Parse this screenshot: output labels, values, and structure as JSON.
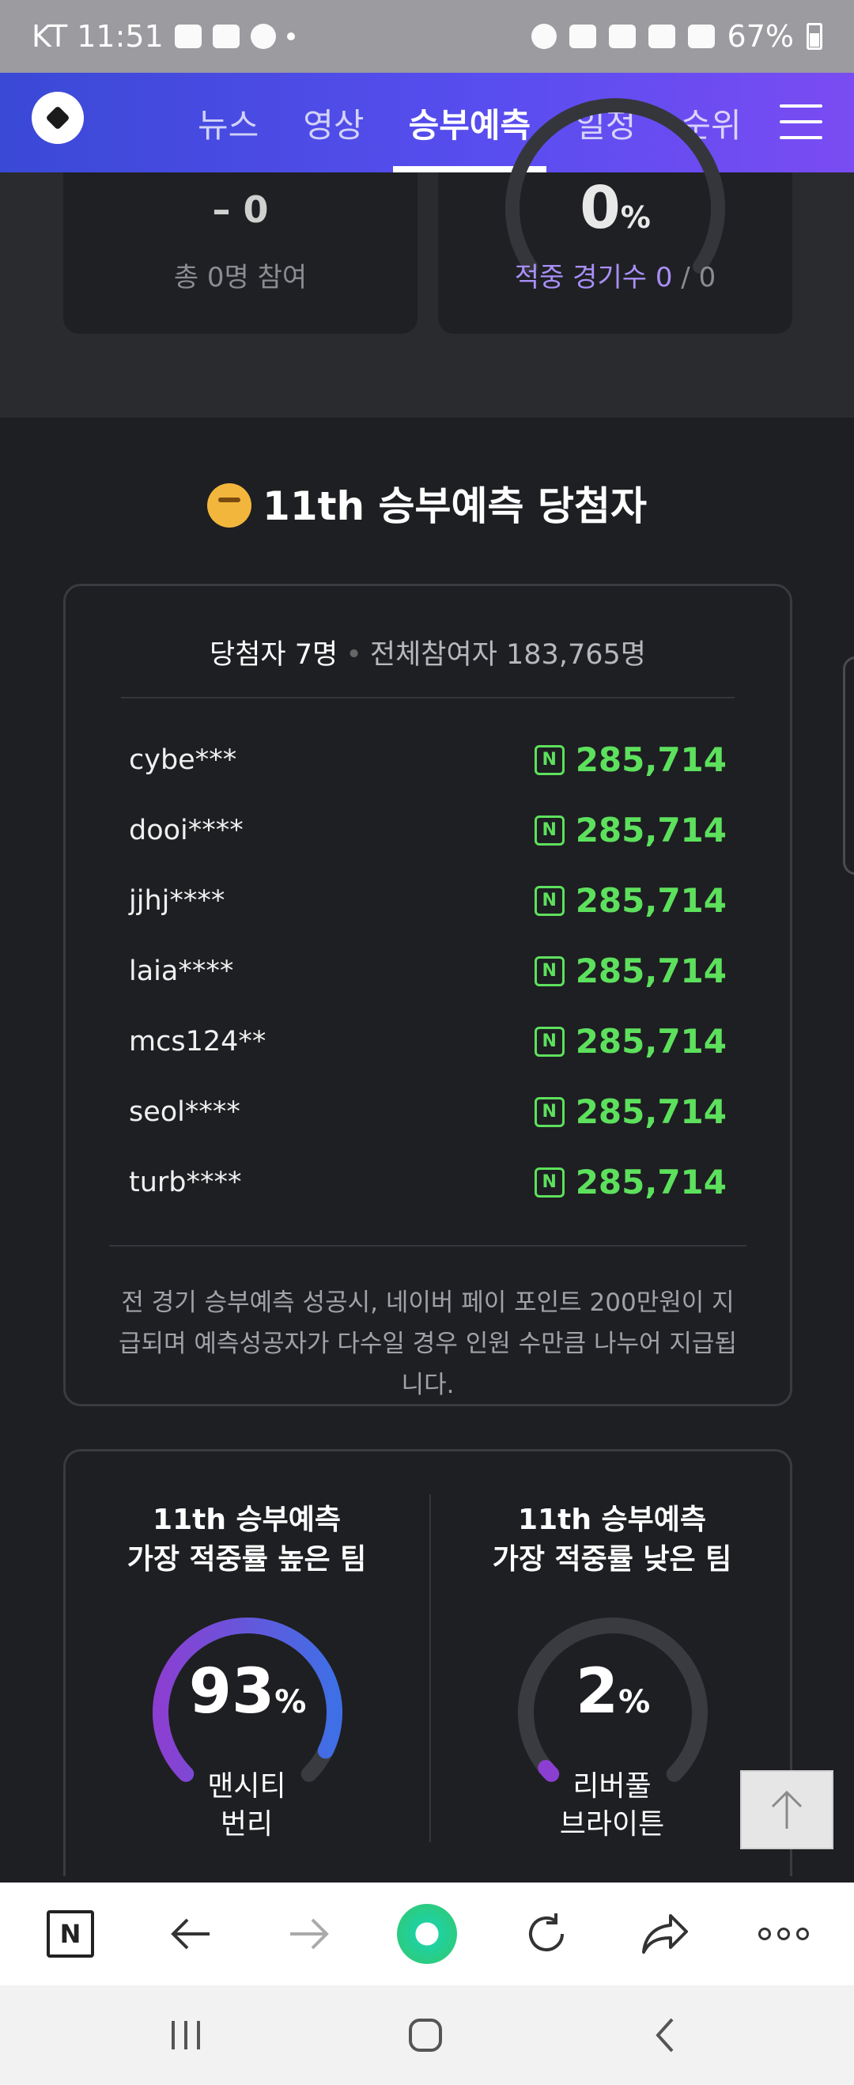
{
  "status_bar": {
    "carrier_time": "KT 11:51",
    "battery": "67%"
  },
  "header": {
    "logo": "soccer-ball-icon",
    "tabs": [
      {
        "label": "뉴스",
        "active": false
      },
      {
        "label": "영상",
        "active": false
      },
      {
        "label": "승부예측",
        "active": true
      },
      {
        "label": "일정",
        "active": false
      },
      {
        "label": "순위",
        "active": false
      }
    ]
  },
  "top_cards": {
    "participants_score": "– 0",
    "participants_text": "총 0명 참여",
    "accuracy_value": "0",
    "accuracy_unit": "%",
    "accuracy_label": "적중 경기수",
    "accuracy_hits": "0",
    "accuracy_sep": "/",
    "accuracy_total": "0"
  },
  "winners": {
    "title": "11th 승부예측 당첨자",
    "winner_count": "당첨자 7명",
    "separator": "•",
    "total_participants": "전체참여자 183,765명",
    "list": [
      {
        "name": "cybe***",
        "amount": "285,714"
      },
      {
        "name": "dooi****",
        "amount": "285,714"
      },
      {
        "name": "jjhj****",
        "amount": "285,714"
      },
      {
        "name": "laia****",
        "amount": "285,714"
      },
      {
        "name": "mcs124**",
        "amount": "285,714"
      },
      {
        "name": "seol****",
        "amount": "285,714"
      },
      {
        "name": "turb****",
        "amount": "285,714"
      }
    ],
    "note": "전 경기 승부예측 성공시, 네이버 페이 포인트 200만원이 지급되며 예측성공자가 다수일 경우 인원 수만큼 나누어 지급됩니다."
  },
  "teams": {
    "high": {
      "title_line1": "11th 승부예측",
      "title_line2": "가장 적중률 높은 팀",
      "value": "93",
      "unit": "%",
      "level": 0.93,
      "name_line1": "맨시티",
      "name_line2": "번리"
    },
    "low": {
      "title_line1": "11th 승부예측",
      "title_line2": "가장 적중률 낮은 팀",
      "value": "2",
      "unit": "%",
      "level": 0.02,
      "name_line1": "리버풀",
      "name_line2": "브라이튼"
    }
  },
  "colors": {
    "accent_green": "#5de15d",
    "accent_purple": "#a98ff8",
    "header_gradient_start": "#3a49d6",
    "header_gradient_end": "#7a4cf2"
  },
  "browser_toolbar": {
    "icons": [
      "naver-n-icon",
      "back-arrow-icon",
      "forward-arrow-icon",
      "green-orb-icon",
      "refresh-icon",
      "share-icon",
      "more-icon"
    ]
  }
}
